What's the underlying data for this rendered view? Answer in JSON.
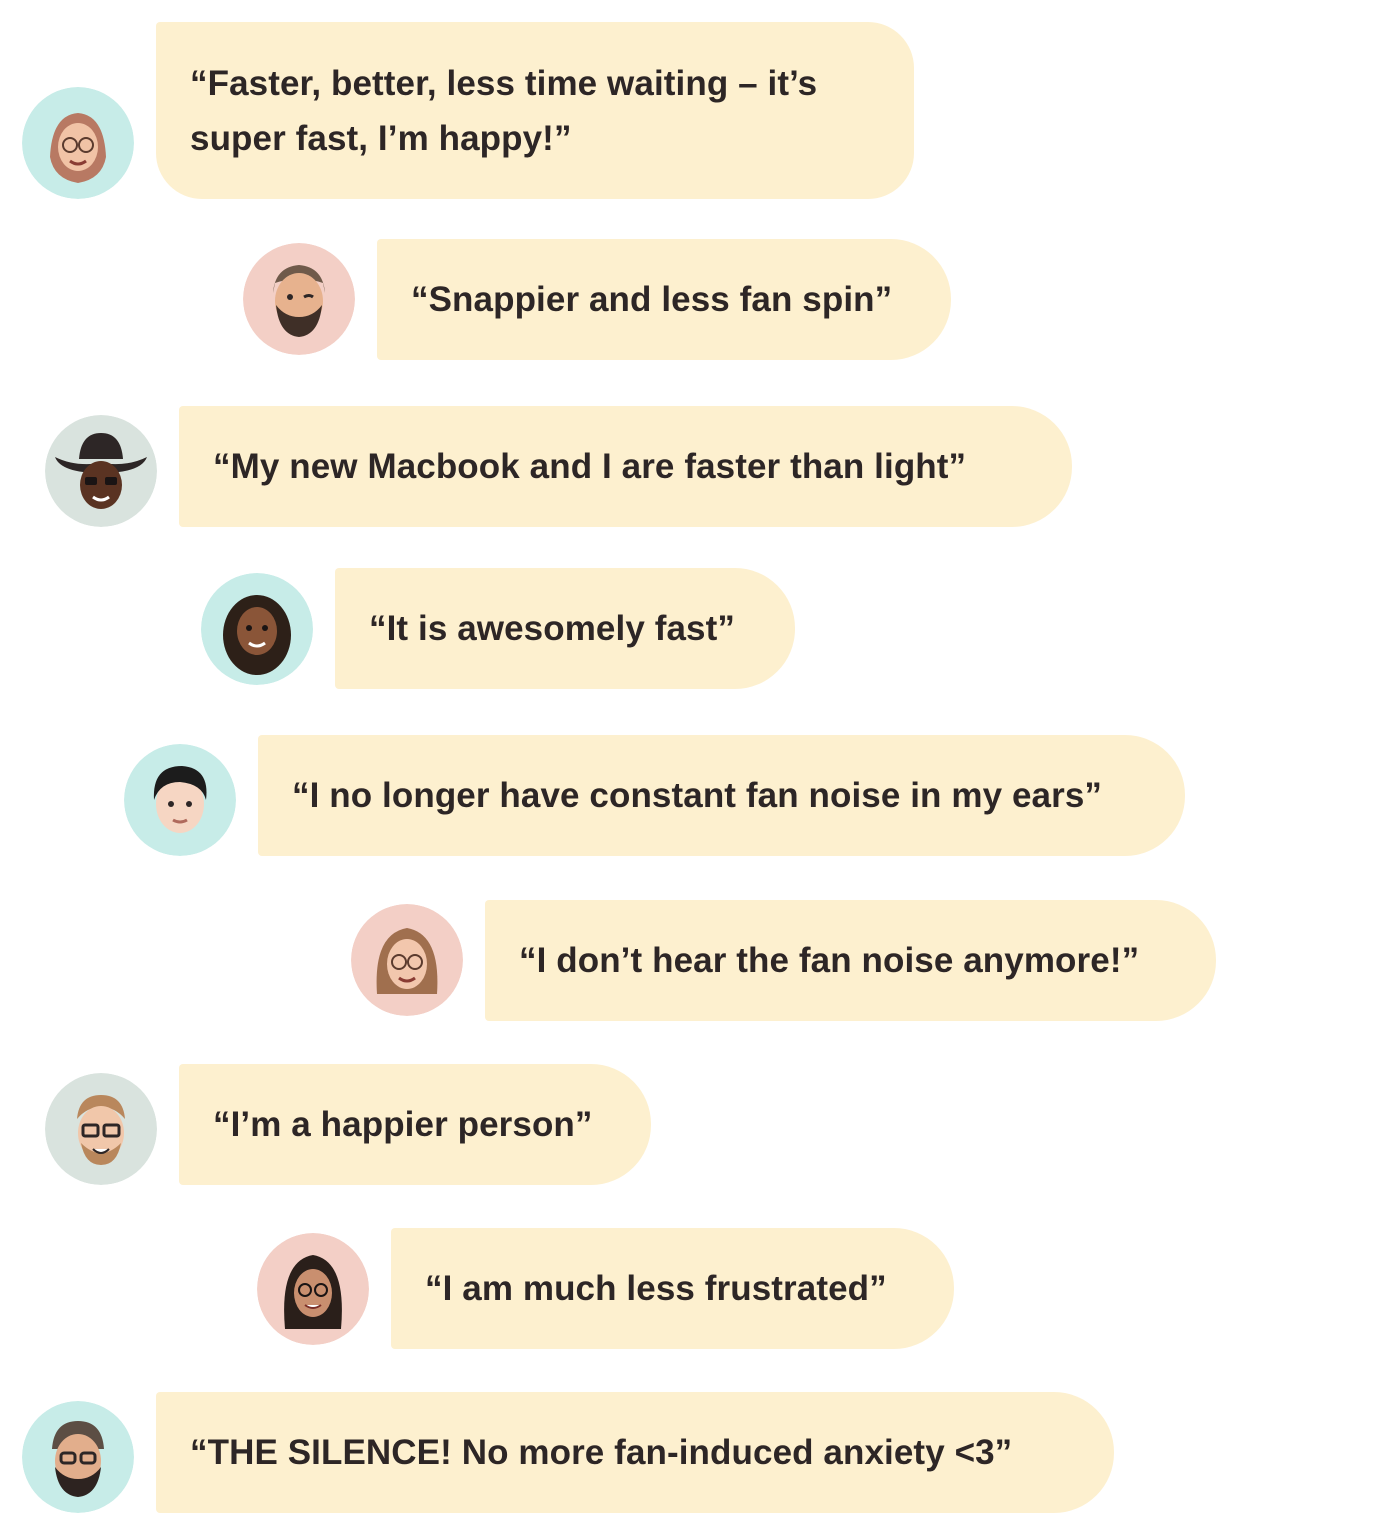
{
  "colors": {
    "bubble": "#fdf0cf",
    "text": "#2d2626",
    "avatar_teal": "#c7ece8",
    "avatar_pink": "#f3cfc6",
    "avatar_gray": "#d9e3de"
  },
  "messages": [
    {
      "avatar": "memoji-hijab-glasses-icon",
      "text": "“Faster, better, less time waiting – it’s super fast, I’m happy!”"
    },
    {
      "avatar": "memoji-bearded-man-wink-icon",
      "text": "“Snappier and less fan spin”"
    },
    {
      "avatar": "memoji-cowboy-hat-icon",
      "text": "“My new Macbook and I are faster than light”"
    },
    {
      "avatar": "memoji-curly-hair-woman-icon",
      "text": "“It is awesomely fast”"
    },
    {
      "avatar": "memoji-dark-hair-man-icon",
      "text": "“I no longer have constant fan noise in my ears”"
    },
    {
      "avatar": "memoji-woman-glasses-icon",
      "text": "“I don’t hear the fan noise anymore!”"
    },
    {
      "avatar": "memoji-man-glasses-beard-icon",
      "text": "“I’m a happier person”"
    },
    {
      "avatar": "memoji-woman-dark-hair-glasses-icon",
      "text": "“I am much less frustrated”"
    },
    {
      "avatar": "memoji-man-beanie-beard-icon",
      "text": "“THE SILENCE! No more fan-induced anxiety <3”"
    }
  ]
}
